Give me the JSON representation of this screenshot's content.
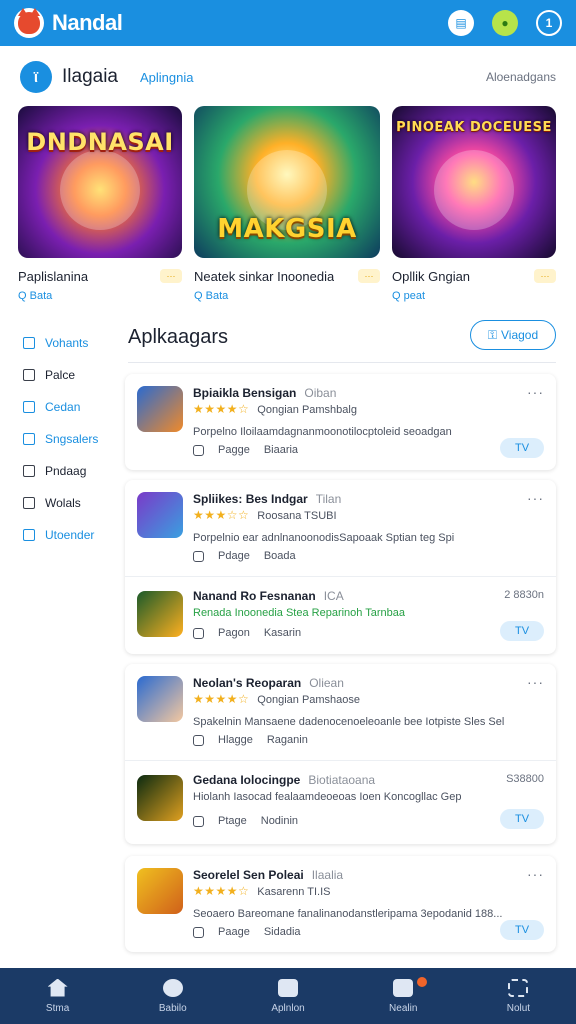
{
  "app": {
    "title": "Nandal"
  },
  "topbar": {
    "icon_a": "▤",
    "icon_b": "●",
    "icon_c": "1"
  },
  "header": {
    "icon": "ϊ",
    "title": "Ilagaia",
    "subtitle": "Aplingnia",
    "right": "Aloenadgans"
  },
  "featured": [
    {
      "logo": "DNDNASAI",
      "name": "Paplislanina",
      "meta": "Q Bata",
      "more": "···"
    },
    {
      "logo": "MAKGSIA",
      "name": "Neatek sinkar Inoonedia",
      "meta": "Q Bata",
      "more": "···"
    },
    {
      "logo": "PINOEAK DOCEUESE",
      "name": "Opllik Gngian",
      "meta": "Q peat",
      "more": "···"
    }
  ],
  "sidebar": [
    {
      "label": "Vohants",
      "active": true
    },
    {
      "label": "Palce",
      "active": false
    },
    {
      "label": "Cedan",
      "active": true
    },
    {
      "label": "Sngsalers",
      "active": true
    },
    {
      "label": "Pndaag",
      "active": false
    },
    {
      "label": "Wolals",
      "active": false
    },
    {
      "label": "Utoender",
      "active": true
    }
  ],
  "section": {
    "title": "Aplkaagars",
    "button": "Viagod"
  },
  "apps": [
    {
      "title": "Bpiaikla Bensigan",
      "tag": "Oiban",
      "stars": "★★★★☆",
      "dev": "Qongian Pamshbalg",
      "desc": "Porpelno Iloilaamdagnanmoonotilocptoleid seoadgan",
      "f1": "Pagge",
      "f2": "Biaaria",
      "get": "TV",
      "more": "···"
    },
    {
      "title": "Spliikes: Bes Indgar",
      "tag": "Tilan",
      "stars": "★★★☆☆",
      "dev": "Roosana TSUBI",
      "desc": "Porpelnio ear adnlnanoonodisSapoaak Sptian teg Spi",
      "f1": "Pdage",
      "f2": "Boada",
      "get": "",
      "more": "···"
    },
    {
      "title": "Nanand Ro Fesnanan",
      "tag": "ICA",
      "stars": "",
      "dev": "Renada Inoonedia Stea Reparinoh Tarnbaa",
      "desc": "",
      "f1": "Pagon",
      "f2": "Kasarin",
      "get": "TV",
      "size": "2 8830n"
    },
    {
      "title": "Neolan's Reoparan",
      "tag": "Oliean",
      "stars": "★★★★☆",
      "dev": "Qongian Pamshaose",
      "desc": "Spakelnin Mansaene dadenocenoeleoanle bee Iotpiste Sles Sel",
      "f1": "Hlagge",
      "f2": "Raganin",
      "get": "",
      "more": "···"
    },
    {
      "title": "Gedana Iolocingpe",
      "tag": "Biotiataoana",
      "stars": "",
      "dev": "Hiolanh Iasocad fealaamdeoeoas Ioen Koncogllac Gep",
      "desc": "",
      "f1": "Ptage",
      "f2": "Nodinin",
      "get": "TV",
      "size": "S38800"
    },
    {
      "title": "Seorelel Sen Poleai",
      "tag": "Ilaalia",
      "stars": "★★★★☆",
      "dev": "Kasarenn TI.IS",
      "desc": "Seoaero Bareomane fanalinanodanstleripama 3epodanid 188...",
      "f1": "Paage",
      "f2": "Sidadia",
      "get": "TV",
      "more": "···"
    }
  ],
  "bottomnav": [
    {
      "label": "Stma",
      "icon": "home"
    },
    {
      "label": "Babilo",
      "icon": "round"
    },
    {
      "label": "Aplnlon",
      "icon": "box"
    },
    {
      "label": "Nealin",
      "icon": "box",
      "badge": true
    },
    {
      "label": "Nolut",
      "icon": "grid"
    }
  ]
}
